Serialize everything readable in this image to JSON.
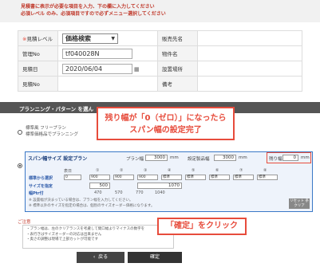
{
  "notice": {
    "line1": "見積書に表示が必要な項目を入力、下の欄に入力してください",
    "line2": "必須レベル のみ、必須項目ですので必ずメニュー選択してください"
  },
  "form": {
    "estimate_level_label": "見積レベル",
    "estimate_level_value": "価格検索",
    "client_label": "販売先名",
    "mgmt_no_label": "管理No",
    "mgmt_no_value": "tf040028N",
    "property_label": "物件名",
    "date_label": "見積日",
    "date_value": "2020/06/04",
    "install_label": "設置場所",
    "estimate_no_label": "見積No",
    "remarks_label": "備考"
  },
  "section": {
    "title": "プランニング・パターン を選ん"
  },
  "free_plan": {
    "title": "標準風 フリープラン",
    "subtitle": "標準価格品でプランニング"
  },
  "span_plan": {
    "header": "スパン幅サイズ 設定プラン",
    "plan_width_label": "プラン幅",
    "plan_width_value": "3000",
    "plan_width_unit": "mm",
    "set_total_label": "設定製品幅",
    "set_total_value": "3000",
    "set_total_unit": "mm",
    "remain_label": "残り幅",
    "remain_value": "0",
    "remain_unit": "mm",
    "col_label": "表日",
    "columns": [
      "①",
      "②",
      "③",
      "④",
      "⑤",
      "⑥",
      "⑦",
      "⑧"
    ],
    "row1_label": "標準から選択",
    "row1_value": "0",
    "std_options": [
      "900",
      "900",
      "900",
      "標準",
      "標準",
      "標準",
      "標準",
      "標準"
    ],
    "row2_label": "サイズを指定",
    "size_values": [
      "500",
      "1070"
    ],
    "row3_label": "幅Ptr付",
    "ptr_values": [
      "470",
      "570",
      "770",
      "1040"
    ],
    "note1": "※ 設置幅が決まっている場合は、プラン幅を入力してください。",
    "note2": "※ 標準以外のサイズを指定の場合は、個別のサイズオーダー価格になります。",
    "reset_label": "リセット 条クリア"
  },
  "caution": {
    "title": "ご注意",
    "lines": [
      "・プラン幅は、左のクリアランスを考慮して間口幅よりマイナスの数字を",
      "・表行きはサイズオーダーの対応は出来ません",
      "・奥さの調整は現場で上部カットが可能です"
    ]
  },
  "buttons": {
    "back": "戻る",
    "back_icon": "chevron-left",
    "confirm": "確定"
  },
  "callouts": {
    "c1_line1": "残り幅が「0（ゼロ）」になったら",
    "c1_line2": "スパン幅の設定完了",
    "c2": "「確定」をクリック"
  },
  "colors": {
    "accent_red": "#e74c3c",
    "accent_blue": "#3a78c6"
  }
}
